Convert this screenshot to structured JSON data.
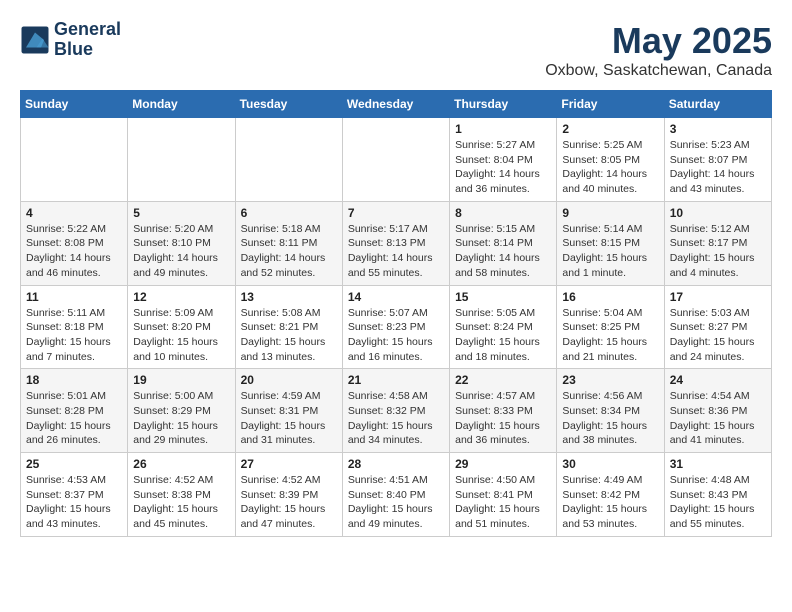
{
  "header": {
    "logo_line1": "General",
    "logo_line2": "Blue",
    "title": "May 2025",
    "subtitle": "Oxbow, Saskatchewan, Canada"
  },
  "weekdays": [
    "Sunday",
    "Monday",
    "Tuesday",
    "Wednesday",
    "Thursday",
    "Friday",
    "Saturday"
  ],
  "weeks": [
    [
      {
        "day": "",
        "info": ""
      },
      {
        "day": "",
        "info": ""
      },
      {
        "day": "",
        "info": ""
      },
      {
        "day": "",
        "info": ""
      },
      {
        "day": "1",
        "info": "Sunrise: 5:27 AM\nSunset: 8:04 PM\nDaylight: 14 hours\nand 36 minutes."
      },
      {
        "day": "2",
        "info": "Sunrise: 5:25 AM\nSunset: 8:05 PM\nDaylight: 14 hours\nand 40 minutes."
      },
      {
        "day": "3",
        "info": "Sunrise: 5:23 AM\nSunset: 8:07 PM\nDaylight: 14 hours\nand 43 minutes."
      }
    ],
    [
      {
        "day": "4",
        "info": "Sunrise: 5:22 AM\nSunset: 8:08 PM\nDaylight: 14 hours\nand 46 minutes."
      },
      {
        "day": "5",
        "info": "Sunrise: 5:20 AM\nSunset: 8:10 PM\nDaylight: 14 hours\nand 49 minutes."
      },
      {
        "day": "6",
        "info": "Sunrise: 5:18 AM\nSunset: 8:11 PM\nDaylight: 14 hours\nand 52 minutes."
      },
      {
        "day": "7",
        "info": "Sunrise: 5:17 AM\nSunset: 8:13 PM\nDaylight: 14 hours\nand 55 minutes."
      },
      {
        "day": "8",
        "info": "Sunrise: 5:15 AM\nSunset: 8:14 PM\nDaylight: 14 hours\nand 58 minutes."
      },
      {
        "day": "9",
        "info": "Sunrise: 5:14 AM\nSunset: 8:15 PM\nDaylight: 15 hours\nand 1 minute."
      },
      {
        "day": "10",
        "info": "Sunrise: 5:12 AM\nSunset: 8:17 PM\nDaylight: 15 hours\nand 4 minutes."
      }
    ],
    [
      {
        "day": "11",
        "info": "Sunrise: 5:11 AM\nSunset: 8:18 PM\nDaylight: 15 hours\nand 7 minutes."
      },
      {
        "day": "12",
        "info": "Sunrise: 5:09 AM\nSunset: 8:20 PM\nDaylight: 15 hours\nand 10 minutes."
      },
      {
        "day": "13",
        "info": "Sunrise: 5:08 AM\nSunset: 8:21 PM\nDaylight: 15 hours\nand 13 minutes."
      },
      {
        "day": "14",
        "info": "Sunrise: 5:07 AM\nSunset: 8:23 PM\nDaylight: 15 hours\nand 16 minutes."
      },
      {
        "day": "15",
        "info": "Sunrise: 5:05 AM\nSunset: 8:24 PM\nDaylight: 15 hours\nand 18 minutes."
      },
      {
        "day": "16",
        "info": "Sunrise: 5:04 AM\nSunset: 8:25 PM\nDaylight: 15 hours\nand 21 minutes."
      },
      {
        "day": "17",
        "info": "Sunrise: 5:03 AM\nSunset: 8:27 PM\nDaylight: 15 hours\nand 24 minutes."
      }
    ],
    [
      {
        "day": "18",
        "info": "Sunrise: 5:01 AM\nSunset: 8:28 PM\nDaylight: 15 hours\nand 26 minutes."
      },
      {
        "day": "19",
        "info": "Sunrise: 5:00 AM\nSunset: 8:29 PM\nDaylight: 15 hours\nand 29 minutes."
      },
      {
        "day": "20",
        "info": "Sunrise: 4:59 AM\nSunset: 8:31 PM\nDaylight: 15 hours\nand 31 minutes."
      },
      {
        "day": "21",
        "info": "Sunrise: 4:58 AM\nSunset: 8:32 PM\nDaylight: 15 hours\nand 34 minutes."
      },
      {
        "day": "22",
        "info": "Sunrise: 4:57 AM\nSunset: 8:33 PM\nDaylight: 15 hours\nand 36 minutes."
      },
      {
        "day": "23",
        "info": "Sunrise: 4:56 AM\nSunset: 8:34 PM\nDaylight: 15 hours\nand 38 minutes."
      },
      {
        "day": "24",
        "info": "Sunrise: 4:54 AM\nSunset: 8:36 PM\nDaylight: 15 hours\nand 41 minutes."
      }
    ],
    [
      {
        "day": "25",
        "info": "Sunrise: 4:53 AM\nSunset: 8:37 PM\nDaylight: 15 hours\nand 43 minutes."
      },
      {
        "day": "26",
        "info": "Sunrise: 4:52 AM\nSunset: 8:38 PM\nDaylight: 15 hours\nand 45 minutes."
      },
      {
        "day": "27",
        "info": "Sunrise: 4:52 AM\nSunset: 8:39 PM\nDaylight: 15 hours\nand 47 minutes."
      },
      {
        "day": "28",
        "info": "Sunrise: 4:51 AM\nSunset: 8:40 PM\nDaylight: 15 hours\nand 49 minutes."
      },
      {
        "day": "29",
        "info": "Sunrise: 4:50 AM\nSunset: 8:41 PM\nDaylight: 15 hours\nand 51 minutes."
      },
      {
        "day": "30",
        "info": "Sunrise: 4:49 AM\nSunset: 8:42 PM\nDaylight: 15 hours\nand 53 minutes."
      },
      {
        "day": "31",
        "info": "Sunrise: 4:48 AM\nSunset: 8:43 PM\nDaylight: 15 hours\nand 55 minutes."
      }
    ]
  ]
}
